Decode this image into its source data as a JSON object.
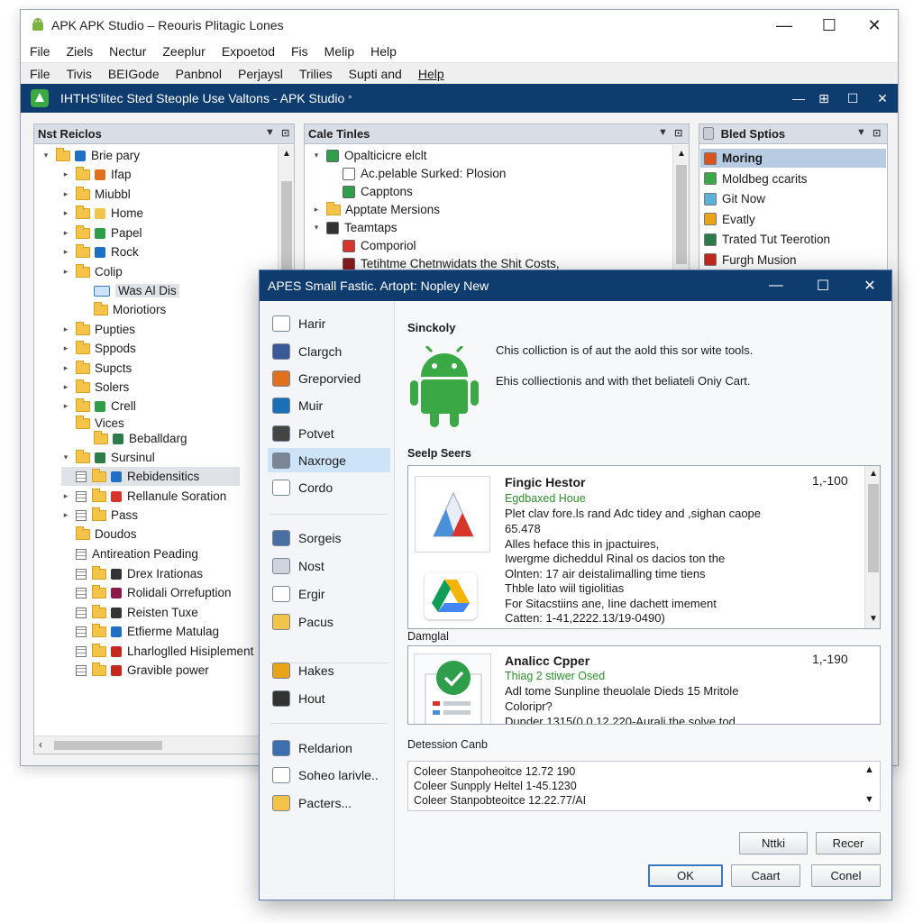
{
  "main_window": {
    "title": "APK APK Studio – Reouris Plitagic Lones",
    "controls": {
      "minimize": "—",
      "maximize": "☐",
      "close": "✕"
    },
    "menu1": [
      "File",
      "Ziels",
      "Nectur",
      "Zeeplur",
      "Expoetod",
      "Fis",
      "Melip",
      "Help"
    ],
    "menu2": [
      "File",
      "Tivis",
      "BEIGode",
      "Panbnol",
      "Perjaysl",
      "Trilies",
      "Supti and",
      "Help"
    ],
    "inner_title": "IHTHS'litec Sted Steople Use Valtons - APK Studio",
    "inner_title_suffix": "°",
    "inner_controls": {
      "minimize": "—",
      "pin": "⊞",
      "maximize": "☐",
      "close": "✕"
    }
  },
  "left_pane": {
    "title": "Nst Reiclos",
    "items": [
      {
        "label": "Brie pary",
        "arrow": "▾"
      },
      {
        "label": "Ifap",
        "arrow": "▸"
      },
      {
        "label": "Miubbl",
        "arrow": "▸"
      },
      {
        "label": "Home",
        "arrow": "▸"
      },
      {
        "label": "Papel",
        "arrow": "▸"
      },
      {
        "label": "Rock",
        "arrow": "▸"
      },
      {
        "label": "Colip",
        "arrow": "▸"
      },
      {
        "label": "Was Al Dis",
        "arrow": ""
      },
      {
        "label": "Moriotiors",
        "arrow": ""
      },
      {
        "label": "Pupties",
        "arrow": "▸"
      },
      {
        "label": "Sppods",
        "arrow": "▸"
      },
      {
        "label": "Supcts",
        "arrow": "▸"
      },
      {
        "label": "Solers",
        "arrow": "▸"
      },
      {
        "label": "Crell",
        "arrow": "▸"
      },
      {
        "label": "Vices",
        "arrow": ""
      },
      {
        "label": "Beballdarg",
        "arrow": ""
      },
      {
        "label": "Sursinul",
        "arrow": "▾"
      },
      {
        "label": "Rebidensitics",
        "arrow": ""
      },
      {
        "label": "Rellanule Soration",
        "arrow": "▸"
      },
      {
        "label": "Pass",
        "arrow": "▸"
      },
      {
        "label": "Doudos",
        "arrow": ""
      },
      {
        "label": "Antireation Peading",
        "arrow": ""
      },
      {
        "label": "Drex Irationas",
        "arrow": ""
      },
      {
        "label": "Rolidali Orrefuption",
        "arrow": ""
      },
      {
        "label": "Reisten Tuxe",
        "arrow": ""
      },
      {
        "label": "Etfierme Matulag",
        "arrow": ""
      },
      {
        "label": "Lharloglled Hisiplement",
        "arrow": ""
      },
      {
        "label": "Gravible power",
        "arrow": ""
      }
    ]
  },
  "middle_pane": {
    "title": "Cale Tinles",
    "items": [
      {
        "label": "Opalticicre elclt",
        "arrow": "▾"
      },
      {
        "label": "Ac.pelable Surked: Plosion",
        "arrow": ""
      },
      {
        "label": "Capptons",
        "arrow": ""
      },
      {
        "label": "Apptate Mersions",
        "arrow": "▸"
      },
      {
        "label": "Teamtaps",
        "arrow": "▾"
      },
      {
        "label": "Comporiol",
        "arrow": ""
      },
      {
        "label": "Tetihtme Chetnwidats the Shit Costs,",
        "arrow": ""
      }
    ]
  },
  "right_pane": {
    "title": "Bled Sptios",
    "items": [
      {
        "label": "Moring",
        "color": "#d9541e"
      },
      {
        "label": "Moldbeg ccarits",
        "color": "#3aa845"
      },
      {
        "label": "Git Now",
        "color": "#5ab3d6"
      },
      {
        "label": "Evatly",
        "color": "#e8a317"
      },
      {
        "label": "Trated Tut Teerotion",
        "color": "#2d7a4a"
      },
      {
        "label": "Furgh Musion",
        "color": "#c6281f"
      }
    ]
  },
  "dialog": {
    "title": "APES Small Fastic. Artopt: Nopley New",
    "controls": {
      "minimize": "—",
      "maximize": "☐",
      "close": "✕"
    },
    "sidebar": [
      {
        "label": "Harir",
        "color": "#ffffff"
      },
      {
        "label": "Clargch",
        "color": "#3b5998"
      },
      {
        "label": "Greporvied",
        "color": "#e0701d"
      },
      {
        "label": "Muir",
        "color": "#1b6fb8"
      },
      {
        "label": "Potvet",
        "color": "#444444"
      },
      {
        "label": "Naxroge",
        "color": "#7a8696"
      },
      {
        "label": "Cordo",
        "color": "#ffffff"
      },
      {
        "label": "Sorgeis",
        "color": "#4a6fa5"
      },
      {
        "label": "Nost",
        "color": "#cfd5de"
      },
      {
        "label": "Ergir",
        "color": "#ffffff"
      },
      {
        "label": "Pacus",
        "color": "#f4c44a"
      },
      {
        "label": "Hakes",
        "color": "#e8a317"
      },
      {
        "label": "Hout",
        "color": "#333333"
      },
      {
        "label": "Reldarion",
        "color": "#3b6fb0"
      },
      {
        "label": "Soheo larivle..",
        "color": "#ffffff"
      },
      {
        "label": "Pacters...",
        "color": "#f4c44a"
      }
    ],
    "heading": "Sinckoly",
    "desc1": "Chis colliction is of aut the aold this sor wite tools.",
    "desc2": "Ehis colliectionis and with thet beliateli Oniy Cart.",
    "section_label": "Seelp Seers",
    "card1": {
      "title": "Fingic Hestor",
      "subtitle": "Egdbaxed Houe",
      "lines": [
        "Plet clav fore.ls rand Adc tidey and ,sighan caope",
        "65.478",
        "Alles heface this in jpactuires,",
        "Iwergme dicheddul Rinal os dacios ton the",
        "Olnten: 17 air deistalimalling time tiens",
        "Thble lato wiil tigiolitias",
        "For Sitacstiins ane, Iine dachett imement",
        "Catten: 1-41,2222.13/19-0490)"
      ],
      "count": "1,-100"
    },
    "between_label": "Damglal",
    "card2": {
      "title": "Analicc Cpper",
      "subtitle": "Thiag 2 stiwer Osed",
      "lines": [
        "Adl tome Sunpline theuolale Dieds 15 Mritole",
        "Coloripr?",
        "Dunder 1315(0,0.12.220-Aurali the solve tod"
      ],
      "count": "1,-190"
    },
    "detection_label": "Detession Canb",
    "detection_lines": [
      "Coleer Stanpoheoitce 12.72 190",
      "Coleer Sunpply Heltel 1-45.1230",
      "Coleer Stanpobteoitce 12.22.77/AI"
    ],
    "btn_top1": "Nttki",
    "btn_top2": "Recer",
    "btn_ok": "OK",
    "btn_cart": "Caart",
    "btn_cancel": "Conel"
  }
}
